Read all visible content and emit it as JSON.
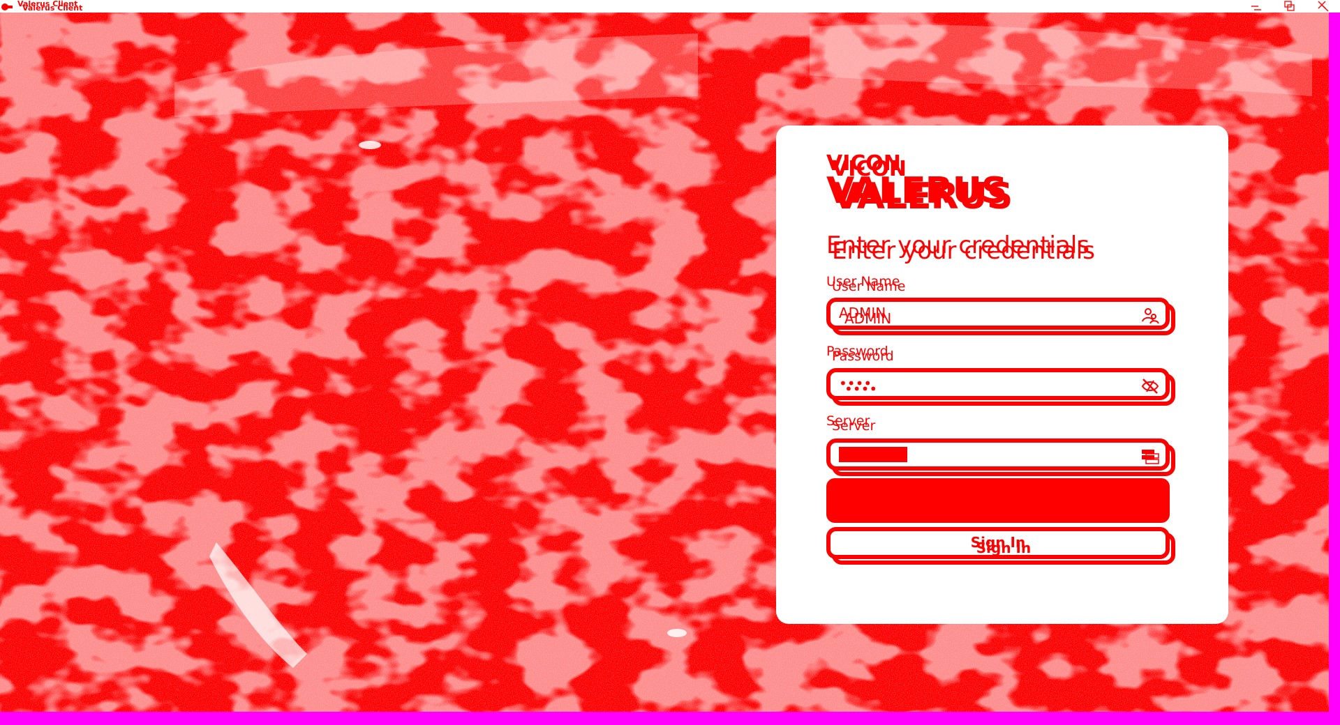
{
  "window": {
    "title": "Valerus Client",
    "controls": [
      "minimize",
      "restore",
      "close"
    ]
  },
  "login": {
    "brand_top": "VICON",
    "brand_name": "VALERUS",
    "heading": "Enter your credentials",
    "username_label": "User Name",
    "username_value": "ADMIN",
    "password_label": "Password",
    "password_value": "••••",
    "server_label": "Server",
    "signin_label": "Sign In"
  },
  "icons": {
    "username": "user-icon",
    "password": "hide-password-icon",
    "server": "server-icon"
  },
  "colors": {
    "accent": "#ff0000",
    "card": "#ffffff",
    "frame": "#ff00ff"
  }
}
